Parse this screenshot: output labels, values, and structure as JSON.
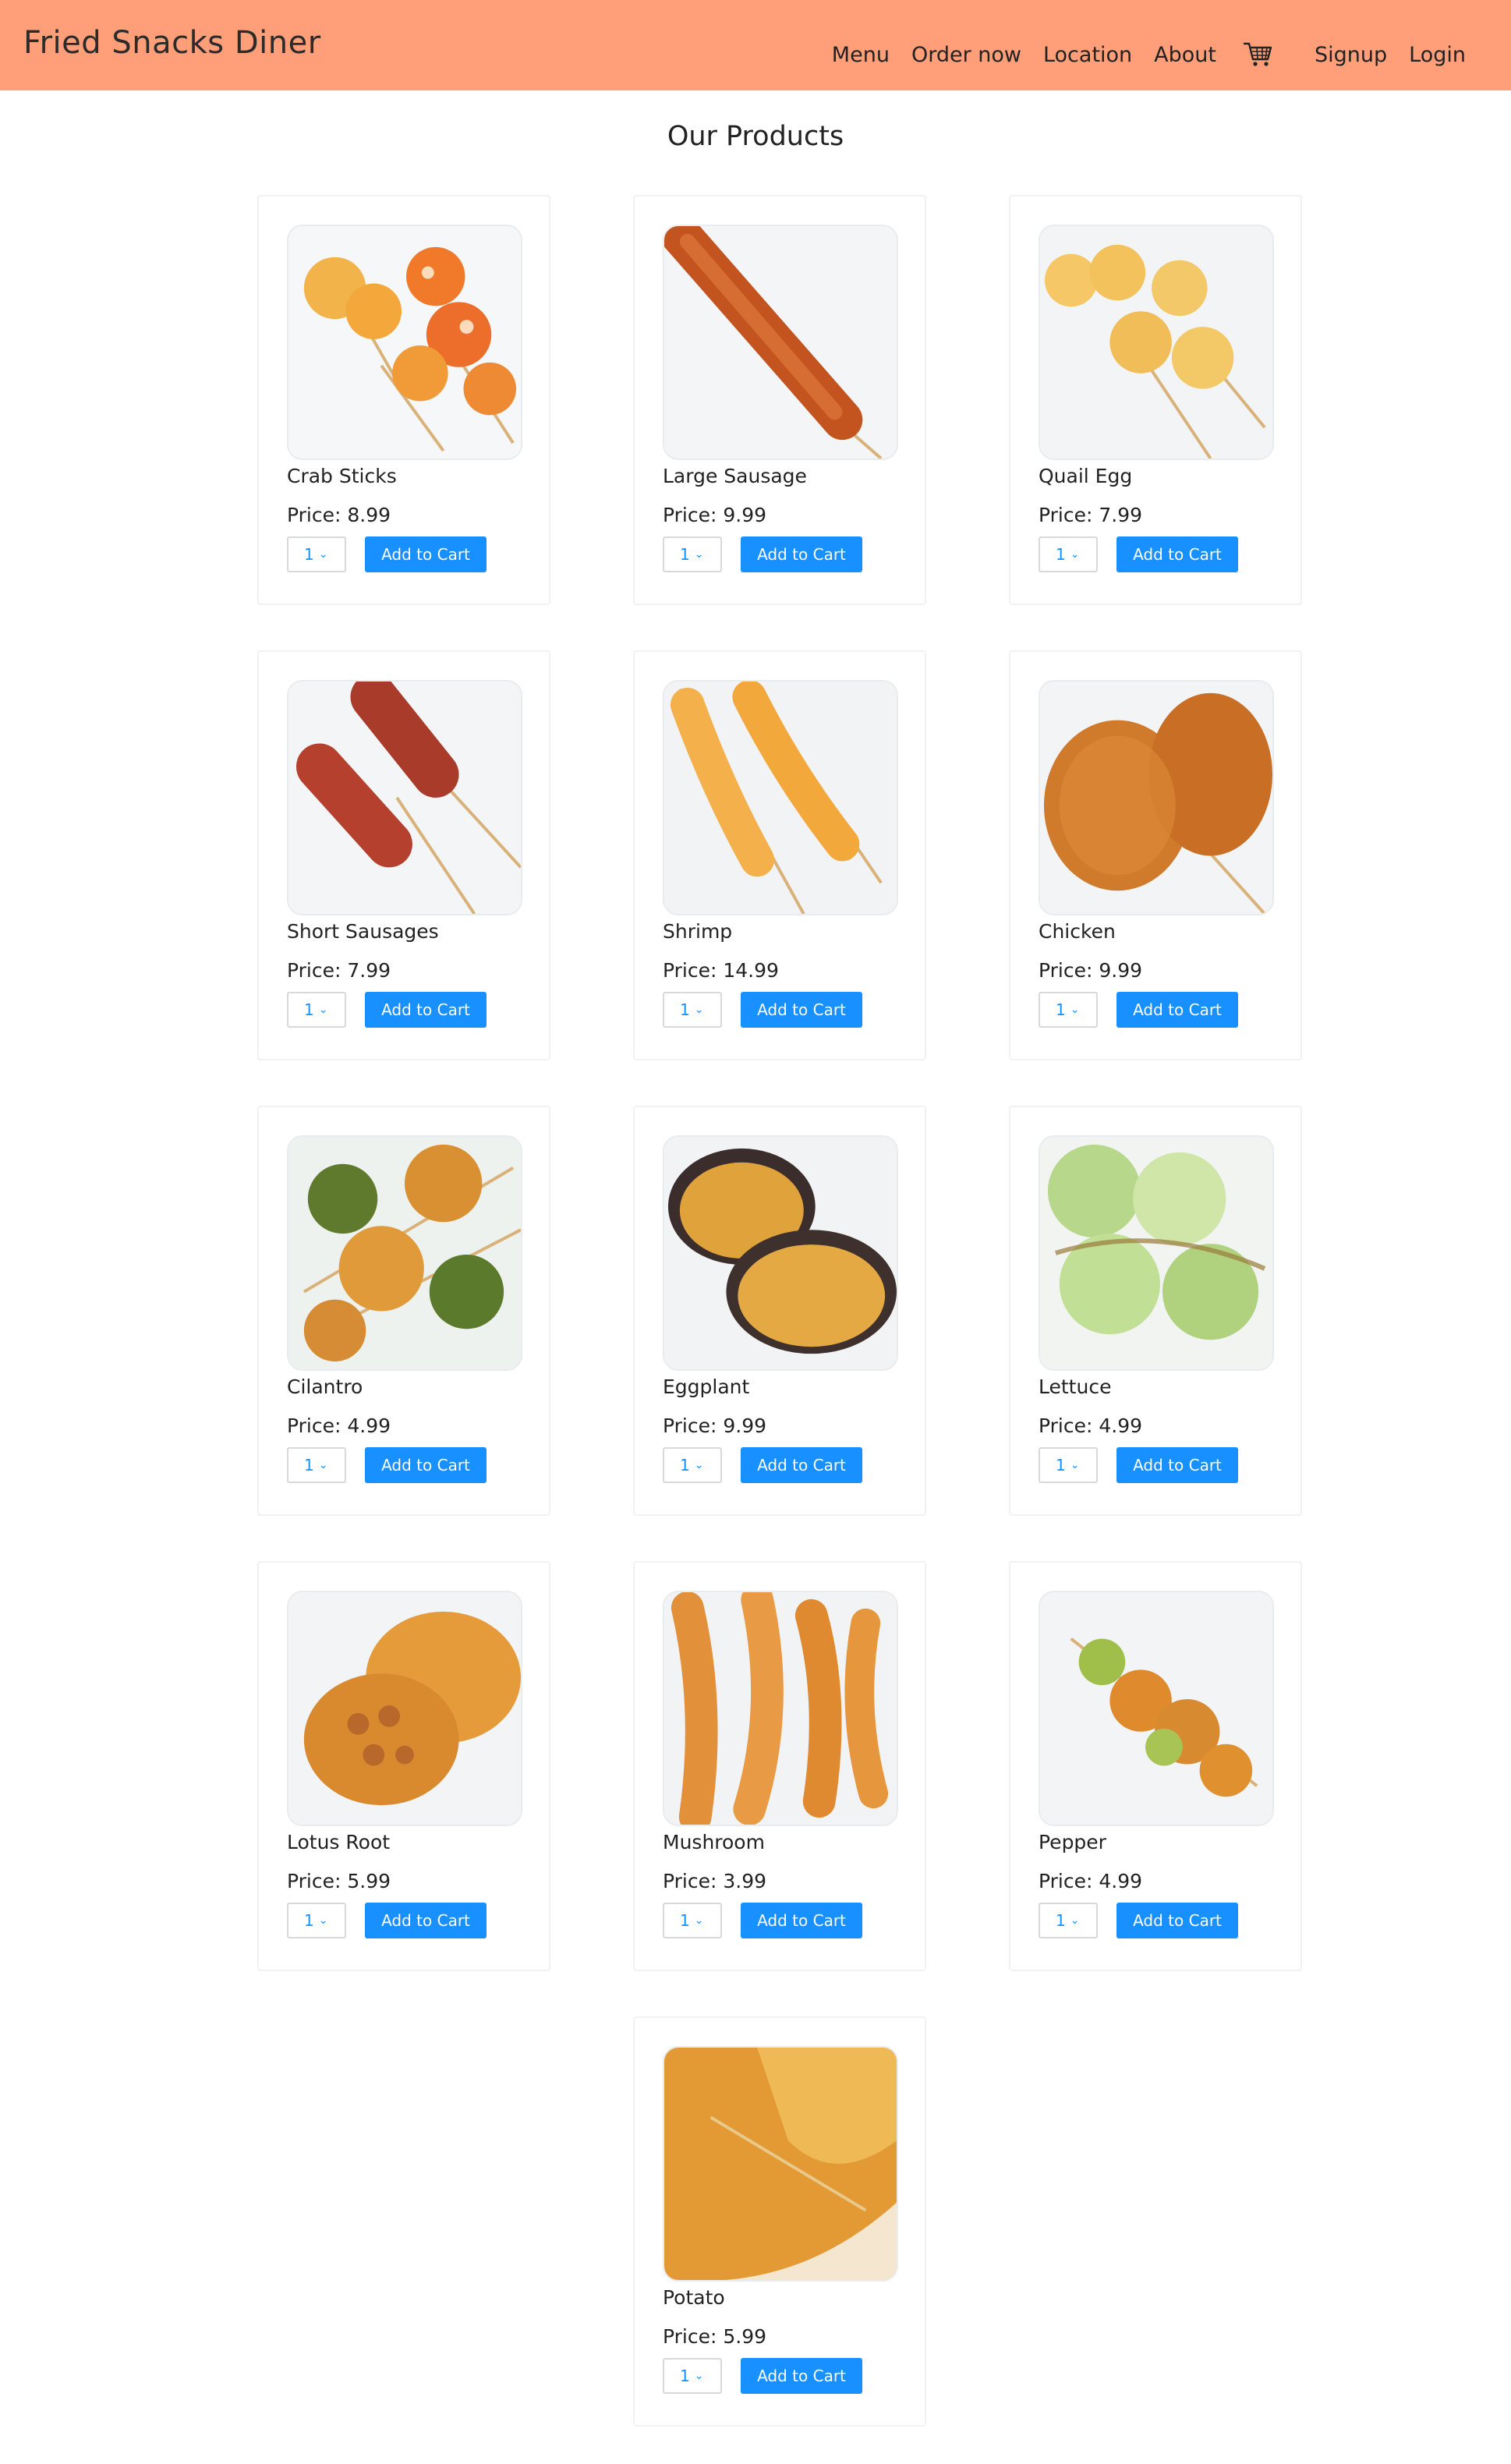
{
  "header": {
    "brand": "Fried Snacks Diner",
    "background_color": "#ff9f79",
    "nav": {
      "menu": "Menu",
      "order_now": "Order now",
      "location": "Location",
      "about": "About",
      "cart_icon": "shopping-cart-icon",
      "signup": "Signup",
      "login": "Login"
    }
  },
  "main": {
    "title": "Our Products",
    "add_to_cart_label": "Add to Cart",
    "button_color": "#1890ff",
    "products": [
      {
        "name": "Crab Sticks",
        "price": "Price: 8.99",
        "qty": "1",
        "image": "crab-sticks-photo"
      },
      {
        "name": "Large Sausage",
        "price": "Price: 9.99",
        "qty": "1",
        "image": "large-sausage-photo"
      },
      {
        "name": "Quail Egg",
        "price": "Price: 7.99",
        "qty": "1",
        "image": "quail-egg-photo"
      },
      {
        "name": "Short Sausages",
        "price": "Price: 7.99",
        "qty": "1",
        "image": "short-sausages-photo"
      },
      {
        "name": "Shrimp",
        "price": "Price: 14.99",
        "qty": "1",
        "image": "shrimp-photo"
      },
      {
        "name": "Chicken",
        "price": "Price: 9.99",
        "qty": "1",
        "image": "chicken-photo"
      },
      {
        "name": "Cilantro",
        "price": "Price: 4.99",
        "qty": "1",
        "image": "cilantro-photo"
      },
      {
        "name": "Eggplant",
        "price": "Price: 9.99",
        "qty": "1",
        "image": "eggplant-photo"
      },
      {
        "name": "Lettuce",
        "price": "Price: 4.99",
        "qty": "1",
        "image": "lettuce-photo"
      },
      {
        "name": "Lotus Root",
        "price": "Price: 5.99",
        "qty": "1",
        "image": "lotus-root-photo"
      },
      {
        "name": "Mushroom",
        "price": "Price: 3.99",
        "qty": "1",
        "image": "mushroom-photo"
      },
      {
        "name": "Pepper",
        "price": "Price: 4.99",
        "qty": "1",
        "image": "pepper-photo"
      },
      {
        "name": "Potato",
        "price": "Price: 5.99",
        "qty": "1",
        "image": "potato-photo"
      }
    ]
  }
}
